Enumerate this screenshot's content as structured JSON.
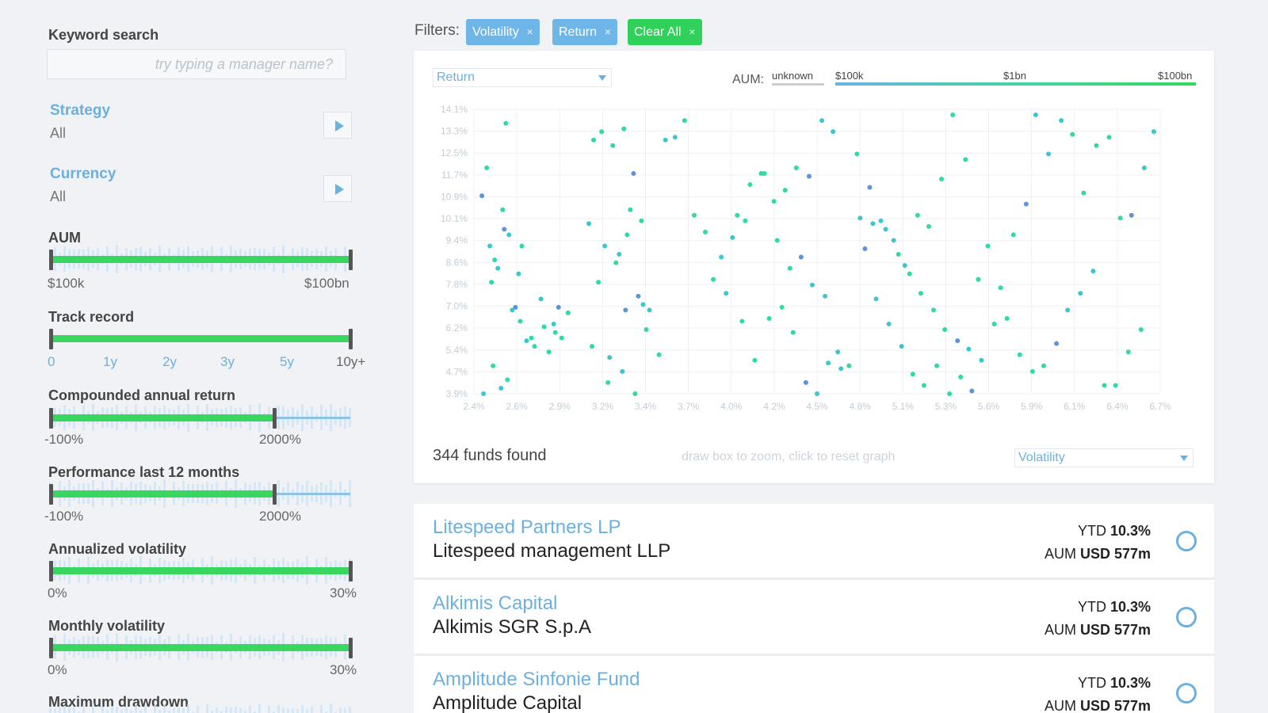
{
  "sidebar": {
    "keyword_label": "Keyword search",
    "keyword_placeholder": "try typing a manager name?",
    "strategy": {
      "title": "Strategy",
      "value": "All"
    },
    "currency": {
      "title": "Currency",
      "value": "All"
    },
    "aum": {
      "label": "AUM",
      "min": "$100k",
      "max": "$100bn"
    },
    "track_record": {
      "label": "Track record",
      "ticks": [
        "0",
        "1y",
        "2y",
        "3y",
        "5y",
        "10y+"
      ]
    },
    "car": {
      "label": "Compounded annual return",
      "min": "-100%",
      "max": "2000%"
    },
    "perf12": {
      "label": "Performance last 12 months",
      "min": "-100%",
      "max": "2000%"
    },
    "ann_vol": {
      "label": "Annualized volatility",
      "min": "0%",
      "max": "30%"
    },
    "mon_vol": {
      "label": "Monthly volatility",
      "min": "0%",
      "max": "30%"
    },
    "max_dd": {
      "label": "Maximum drawdown"
    }
  },
  "filters": {
    "label": "Filters:",
    "chips": [
      {
        "label": "Volatility",
        "color": "#6fb6e8"
      },
      {
        "label": "Return",
        "color": "#6fb6e8"
      },
      {
        "label": "Clear All",
        "color": "#2fd15b"
      }
    ],
    "remove_glyph": "×"
  },
  "chart": {
    "y_select": "Return",
    "x_select": "Volatility",
    "aum_legend": {
      "label": "AUM:",
      "unknown": "unknown",
      "stops": [
        "$100k",
        "$1bn",
        "$100bn"
      ]
    },
    "funds_found": "344 funds found",
    "hint": "draw box to zoom, click to reset graph"
  },
  "chart_data": {
    "type": "scatter",
    "xlabel": "",
    "ylabel": "",
    "x_ticks": [
      "2.4%",
      "2.6%",
      "2.9%",
      "3.2%",
      "3.4%",
      "3.7%",
      "4.0%",
      "4.2%",
      "4.5%",
      "4.8%",
      "5.1%",
      "5.3%",
      "5.6%",
      "5.9%",
      "6.1%",
      "6.4%",
      "6.7%"
    ],
    "y_ticks": [
      "14.1%",
      "13.3%",
      "12.5%",
      "11.7%",
      "10.9%",
      "10.1%",
      "9.4%",
      "8.6%",
      "7.8%",
      "7.0%",
      "6.2%",
      "5.4%",
      "4.7%",
      "3.9%"
    ],
    "xlim": [
      2.4,
      6.7
    ],
    "ylim": [
      3.9,
      14.1
    ],
    "grid": true,
    "colors": {
      "small": "#2fdc9b",
      "mid": "#3cc7cf",
      "large": "#5b93dc"
    },
    "series": [
      {
        "x": [
          2.6,
          2.45,
          2.5,
          2.55,
          2.62,
          2.7,
          2.78,
          2.48,
          2.53,
          2.58,
          2.66,
          2.73,
          2.82,
          2.9,
          2.95,
          2.52,
          2.61,
          2.69,
          2.87,
          2.93,
          2.46,
          2.57,
          2.64,
          2.76,
          2.84,
          2.91,
          2.99,
          2.51,
          2.59,
          2.68
        ],
        "y": [
          13.6,
          11.0,
          9.2,
          8.4,
          9.6,
          9.2,
          5.6,
          12.0,
          8.7,
          10.5,
          7.0,
          5.8,
          7.3,
          6.4,
          5.9,
          4.9,
          4.4,
          6.5,
          5.4,
          7.0,
          3.9,
          4.1,
          6.9,
          5.9,
          6.3,
          6.1,
          6.8,
          7.9,
          9.8,
          8.2
        ],
        "size": "mixed"
      },
      {
        "x": [
          3.15,
          3.2,
          3.27,
          3.34,
          3.4,
          3.12,
          3.22,
          3.31,
          3.38,
          3.45,
          3.18,
          3.29,
          3.36,
          3.43,
          3.5,
          3.25,
          3.33,
          3.41,
          3.48,
          3.56,
          3.14,
          3.24,
          3.35,
          3.46,
          3.6,
          3.66,
          3.72,
          3.78,
          3.85,
          3.9
        ],
        "y": [
          13.0,
          13.3,
          12.8,
          13.4,
          11.8,
          10.0,
          9.2,
          8.9,
          10.5,
          10.1,
          7.9,
          8.6,
          9.6,
          7.4,
          6.9,
          5.2,
          4.7,
          3.9,
          6.2,
          5.3,
          5.6,
          4.3,
          6.9,
          7.1,
          13.0,
          13.1,
          13.7,
          10.3,
          9.7,
          8.0
        ],
        "size": "mixed"
      },
      {
        "x": [
          3.95,
          4.02,
          4.1,
          4.2,
          4.28,
          4.35,
          4.42,
          4.5,
          4.58,
          4.65,
          3.98,
          4.08,
          4.16,
          4.25,
          4.33,
          4.4,
          4.48,
          4.55,
          4.62,
          4.7,
          4.05,
          4.13,
          4.22,
          4.3,
          4.38,
          4.45,
          4.52,
          4.6,
          4.68,
          4.75
        ],
        "y": [
          8.8,
          9.5,
          10.1,
          11.8,
          10.8,
          11.2,
          12.0,
          11.7,
          13.7,
          13.3,
          7.5,
          6.5,
          5.1,
          6.6,
          7.0,
          6.1,
          4.3,
          3.9,
          5.0,
          4.8,
          10.3,
          11.4,
          11.8,
          9.4,
          8.4,
          8.8,
          7.8,
          7.4,
          5.4,
          4.9
        ],
        "size": "mixed"
      },
      {
        "x": [
          4.8,
          4.88,
          4.95,
          5.03,
          5.1,
          5.18,
          5.25,
          5.33,
          5.4,
          5.48,
          4.85,
          4.92,
          5.0,
          5.08,
          5.15,
          5.22,
          5.3,
          5.38,
          5.45,
          5.52,
          4.82,
          4.9,
          4.98,
          5.06,
          5.13,
          5.2,
          5.28,
          5.35,
          5.43,
          5.5
        ],
        "y": [
          12.5,
          11.3,
          10.1,
          9.4,
          8.5,
          10.3,
          9.9,
          11.6,
          13.9,
          12.3,
          9.1,
          7.3,
          6.4,
          5.6,
          4.6,
          4.2,
          4.9,
          3.9,
          4.5,
          4.0,
          10.2,
          10.0,
          9.8,
          8.9,
          8.2,
          7.5,
          6.9,
          6.2,
          5.8,
          5.5
        ],
        "size": "mixed"
      },
      {
        "x": [
          5.56,
          5.62,
          5.7,
          5.78,
          5.86,
          5.92,
          6.0,
          6.08,
          6.15,
          6.22,
          6.3,
          6.38,
          6.45,
          6.52,
          6.6,
          6.66,
          5.58,
          5.66,
          5.74,
          5.82,
          5.9,
          5.97,
          6.05,
          6.12,
          6.2,
          6.28,
          6.35,
          6.42,
          6.5,
          6.58
        ],
        "y": [
          8.0,
          9.2,
          7.7,
          9.6,
          10.7,
          13.9,
          12.5,
          13.7,
          13.2,
          11.1,
          12.8,
          13.1,
          10.2,
          10.3,
          12.0,
          13.3,
          5.1,
          6.4,
          6.6,
          5.3,
          4.7,
          4.9,
          5.7,
          6.9,
          7.5,
          8.3,
          4.2,
          4.2,
          5.4,
          6.2
        ],
        "size": "mixed"
      }
    ]
  },
  "funds": [
    {
      "name": "Litespeed Partners LP",
      "manager": "Litespeed management LLP",
      "ytd_label": "YTD",
      "ytd": "10.3%",
      "aum_label": "AUM",
      "aum": "USD 577m"
    },
    {
      "name": "Alkimis Capital",
      "manager": "Alkimis SGR S.p.A",
      "ytd_label": "YTD",
      "ytd": "10.3%",
      "aum_label": "AUM",
      "aum": "USD 577m"
    },
    {
      "name": "Amplitude Sinfonie Fund",
      "manager": "Amplitude Capital",
      "ytd_label": "YTD",
      "ytd": "10.3%",
      "aum_label": "AUM",
      "aum": "USD 577m"
    }
  ]
}
